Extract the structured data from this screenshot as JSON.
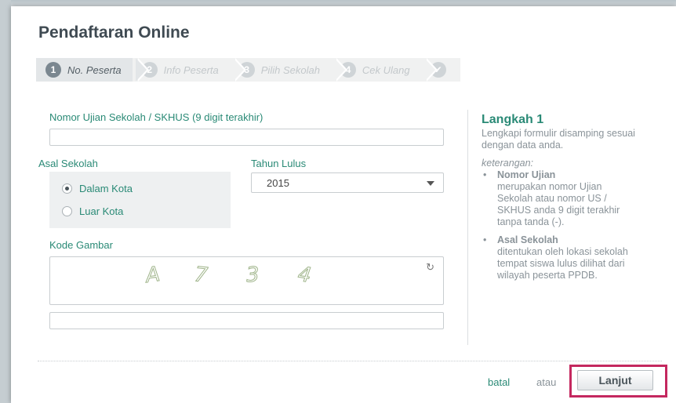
{
  "dialog": {
    "title": "Pendaftaran Online"
  },
  "steps": [
    {
      "num": "1",
      "label": "No. Peserta"
    },
    {
      "num": "2",
      "label": "Info Peserta"
    },
    {
      "num": "3",
      "label": "Pilih Sekolah"
    },
    {
      "num": "4",
      "label": "Cek Ulang"
    },
    {
      "num": "",
      "label": "",
      "icon": "check-icon"
    }
  ],
  "form": {
    "nomor_label": "Nomor Ujian Sekolah / SKHUS (9 digit terakhir)",
    "nomor_value": "",
    "asal_label": "Asal Sekolah",
    "asal_options": [
      "Dalam Kota",
      "Luar Kota"
    ],
    "asal_selected": "Dalam Kota",
    "tahun_label": "Tahun Lulus",
    "tahun_value": "2015",
    "kode_label": "Kode Gambar",
    "captcha_chars": [
      "A",
      "7",
      "3",
      "4"
    ],
    "captcha_input_value": ""
  },
  "help": {
    "title": "Langkah 1",
    "intro": "Lengkapi formulir disamping sesuai dengan data anda.",
    "note_label": "keterangan:",
    "items": [
      {
        "term": "Nomor Ujian",
        "desc": "merupakan nomor Ujian Sekolah atau nomor US / SKHUS anda 9 digit terakhir tanpa tanda (-)."
      },
      {
        "term": "Asal Sekolah",
        "desc": "ditentukan oleh lokasi sekolah tempat siswa lulus dilihat dari wilayah peserta PPDB."
      }
    ]
  },
  "footer": {
    "cancel": "batal",
    "or": "atau",
    "next": "Lanjut"
  },
  "colors": {
    "accent": "#2a8a76",
    "highlight": "#c4285f",
    "title": "#3f4a52"
  }
}
